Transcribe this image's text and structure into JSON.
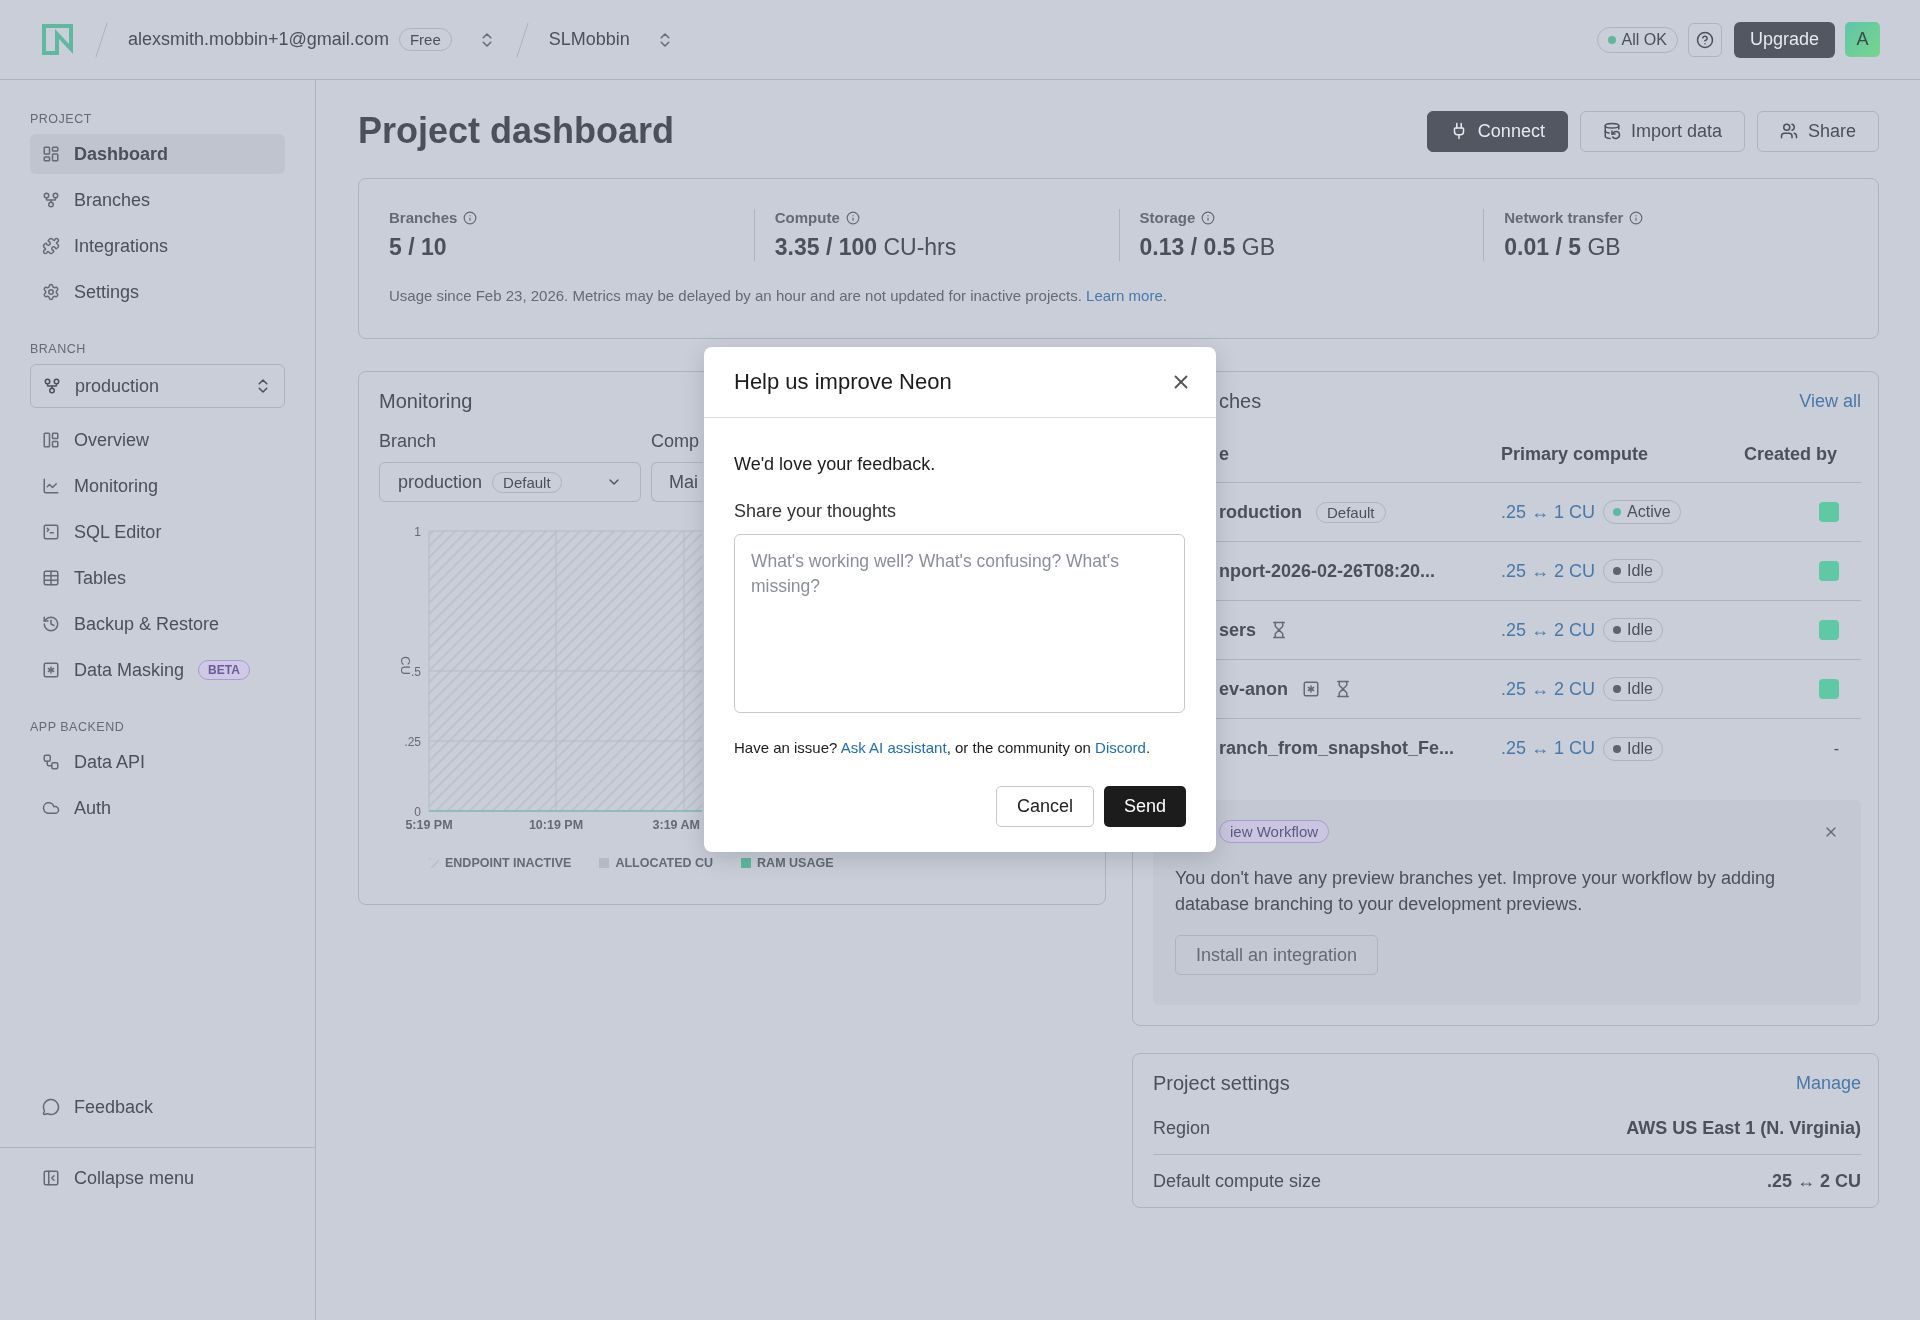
{
  "header": {
    "account": "alexsmith.mobbin+1@gmail.com",
    "plan": "Free",
    "project": "SLMobbin",
    "status": "All OK",
    "status_ok": true,
    "upgrade": "Upgrade",
    "avatar": "A"
  },
  "sidebar": {
    "sections": [
      {
        "title": "PROJECT",
        "items": [
          {
            "label": "Dashboard",
            "selected": true
          },
          {
            "label": "Branches",
            "selected": false
          },
          {
            "label": "Integrations",
            "selected": false
          },
          {
            "label": "Settings",
            "selected": false
          }
        ]
      },
      {
        "title": "BRANCH",
        "branch_selector": "production",
        "items": [
          {
            "label": "Overview",
            "selected": false
          },
          {
            "label": "Monitoring",
            "selected": false
          },
          {
            "label": "SQL Editor",
            "selected": false
          },
          {
            "label": "Tables",
            "selected": false
          },
          {
            "label": "Backup & Restore",
            "selected": false
          },
          {
            "label": "Data Masking",
            "badge": "BETA",
            "selected": false
          }
        ]
      },
      {
        "title": "APP BACKEND",
        "items": [
          {
            "label": "Data API",
            "selected": false
          },
          {
            "label": "Auth",
            "selected": false
          }
        ]
      }
    ],
    "feedback": "Feedback",
    "collapse": "Collapse menu"
  },
  "page": {
    "title": "Project dashboard",
    "actions": [
      {
        "label": "Connect",
        "primary": true
      },
      {
        "label": "Import data",
        "primary": false
      },
      {
        "label": "Share",
        "primary": false
      }
    ]
  },
  "usage": {
    "metrics": [
      {
        "label": "Branches",
        "value": "5 / 10"
      },
      {
        "label": "Compute",
        "value": "3.35 / 100",
        "unit": "CU-hrs"
      },
      {
        "label": "Storage",
        "value": "0.13 / 0.5",
        "unit": "GB"
      },
      {
        "label": "Network transfer",
        "value": "0.01 / 5",
        "unit": "GB"
      }
    ],
    "note": "Usage since Feb 23, 2026. Metrics may be delayed by an hour and are not updated for inactive projects. ",
    "link": "Learn more",
    "note_end": "."
  },
  "monitoring": {
    "title": "Monitoring",
    "branch_label": "Branch",
    "branch_value": "production",
    "branch_badge": "Default",
    "compute_label": "Comp",
    "compute_value": "Mai",
    "chart": {
      "y_label": "CU",
      "y_ticks": [
        "1",
        ".5",
        ".25",
        "0"
      ],
      "x_ticks": [
        "5:19 PM",
        "10:19 PM",
        "3:19 AM"
      ],
      "legend": [
        {
          "label": "ENDPOINT INACTIVE",
          "kind": "hatch"
        },
        {
          "label": "ALLOCATED CU",
          "kind": "block",
          "color": "#b4b9c3"
        },
        {
          "label": "RAM USAGE",
          "kind": "block",
          "color": "#5fb89f"
        }
      ]
    }
  },
  "branches": {
    "title": "ches",
    "view_all": "View all",
    "columns": [
      "e",
      "Primary compute",
      "Created by"
    ],
    "rows": [
      {
        "name": "roduction",
        "badge": "Default",
        "masked": false,
        "expiring": false,
        "compute": ".25 ↔ 1 CU",
        "status": "Active",
        "active": true,
        "creator_avatar": true
      },
      {
        "name": "nport-2026-02-26T08:20...",
        "masked": false,
        "expiring": false,
        "compute": ".25 ↔ 2 CU",
        "status": "Idle",
        "active": false,
        "creator_avatar": true
      },
      {
        "name": "sers",
        "masked": false,
        "expiring": true,
        "compute": ".25 ↔ 2 CU",
        "status": "Idle",
        "active": false,
        "creator_avatar": true
      },
      {
        "name": "ev-anon",
        "masked": true,
        "expiring": true,
        "compute": ".25 ↔ 2 CU",
        "status": "Idle",
        "active": false,
        "creator_avatar": true
      },
      {
        "name": "ranch_from_snapshot_Fe...",
        "masked": false,
        "expiring": false,
        "compute": ".25 ↔ 1 CU",
        "status": "Idle",
        "active": false,
        "creator_avatar": false,
        "created_by": "-"
      }
    ],
    "preview": {
      "badge": "iew Workflow",
      "text": "You don't have any preview branches yet. Improve your workflow by adding database branching to your development previews.",
      "button": "Install an integration"
    }
  },
  "settings": {
    "title": "Project settings",
    "manage": "Manage",
    "rows": [
      {
        "label": "Region",
        "value": "AWS US East 1 (N. Virginia)"
      },
      {
        "label": "Default compute size",
        "value": ".25 ↔ 2 CU"
      }
    ]
  },
  "modal": {
    "title": "Help us improve Neon",
    "intro": "We'd love your feedback.",
    "field_label": "Share your thoughts",
    "placeholder": "What's working well? What's confusing? What's missing?",
    "help_prefix": "Have an issue? ",
    "help_link1": "Ask AI assistant",
    "help_middle": ", or the community on ",
    "help_link2": "Discord",
    "help_end": ".",
    "cancel": "Cancel",
    "send": "Send"
  }
}
